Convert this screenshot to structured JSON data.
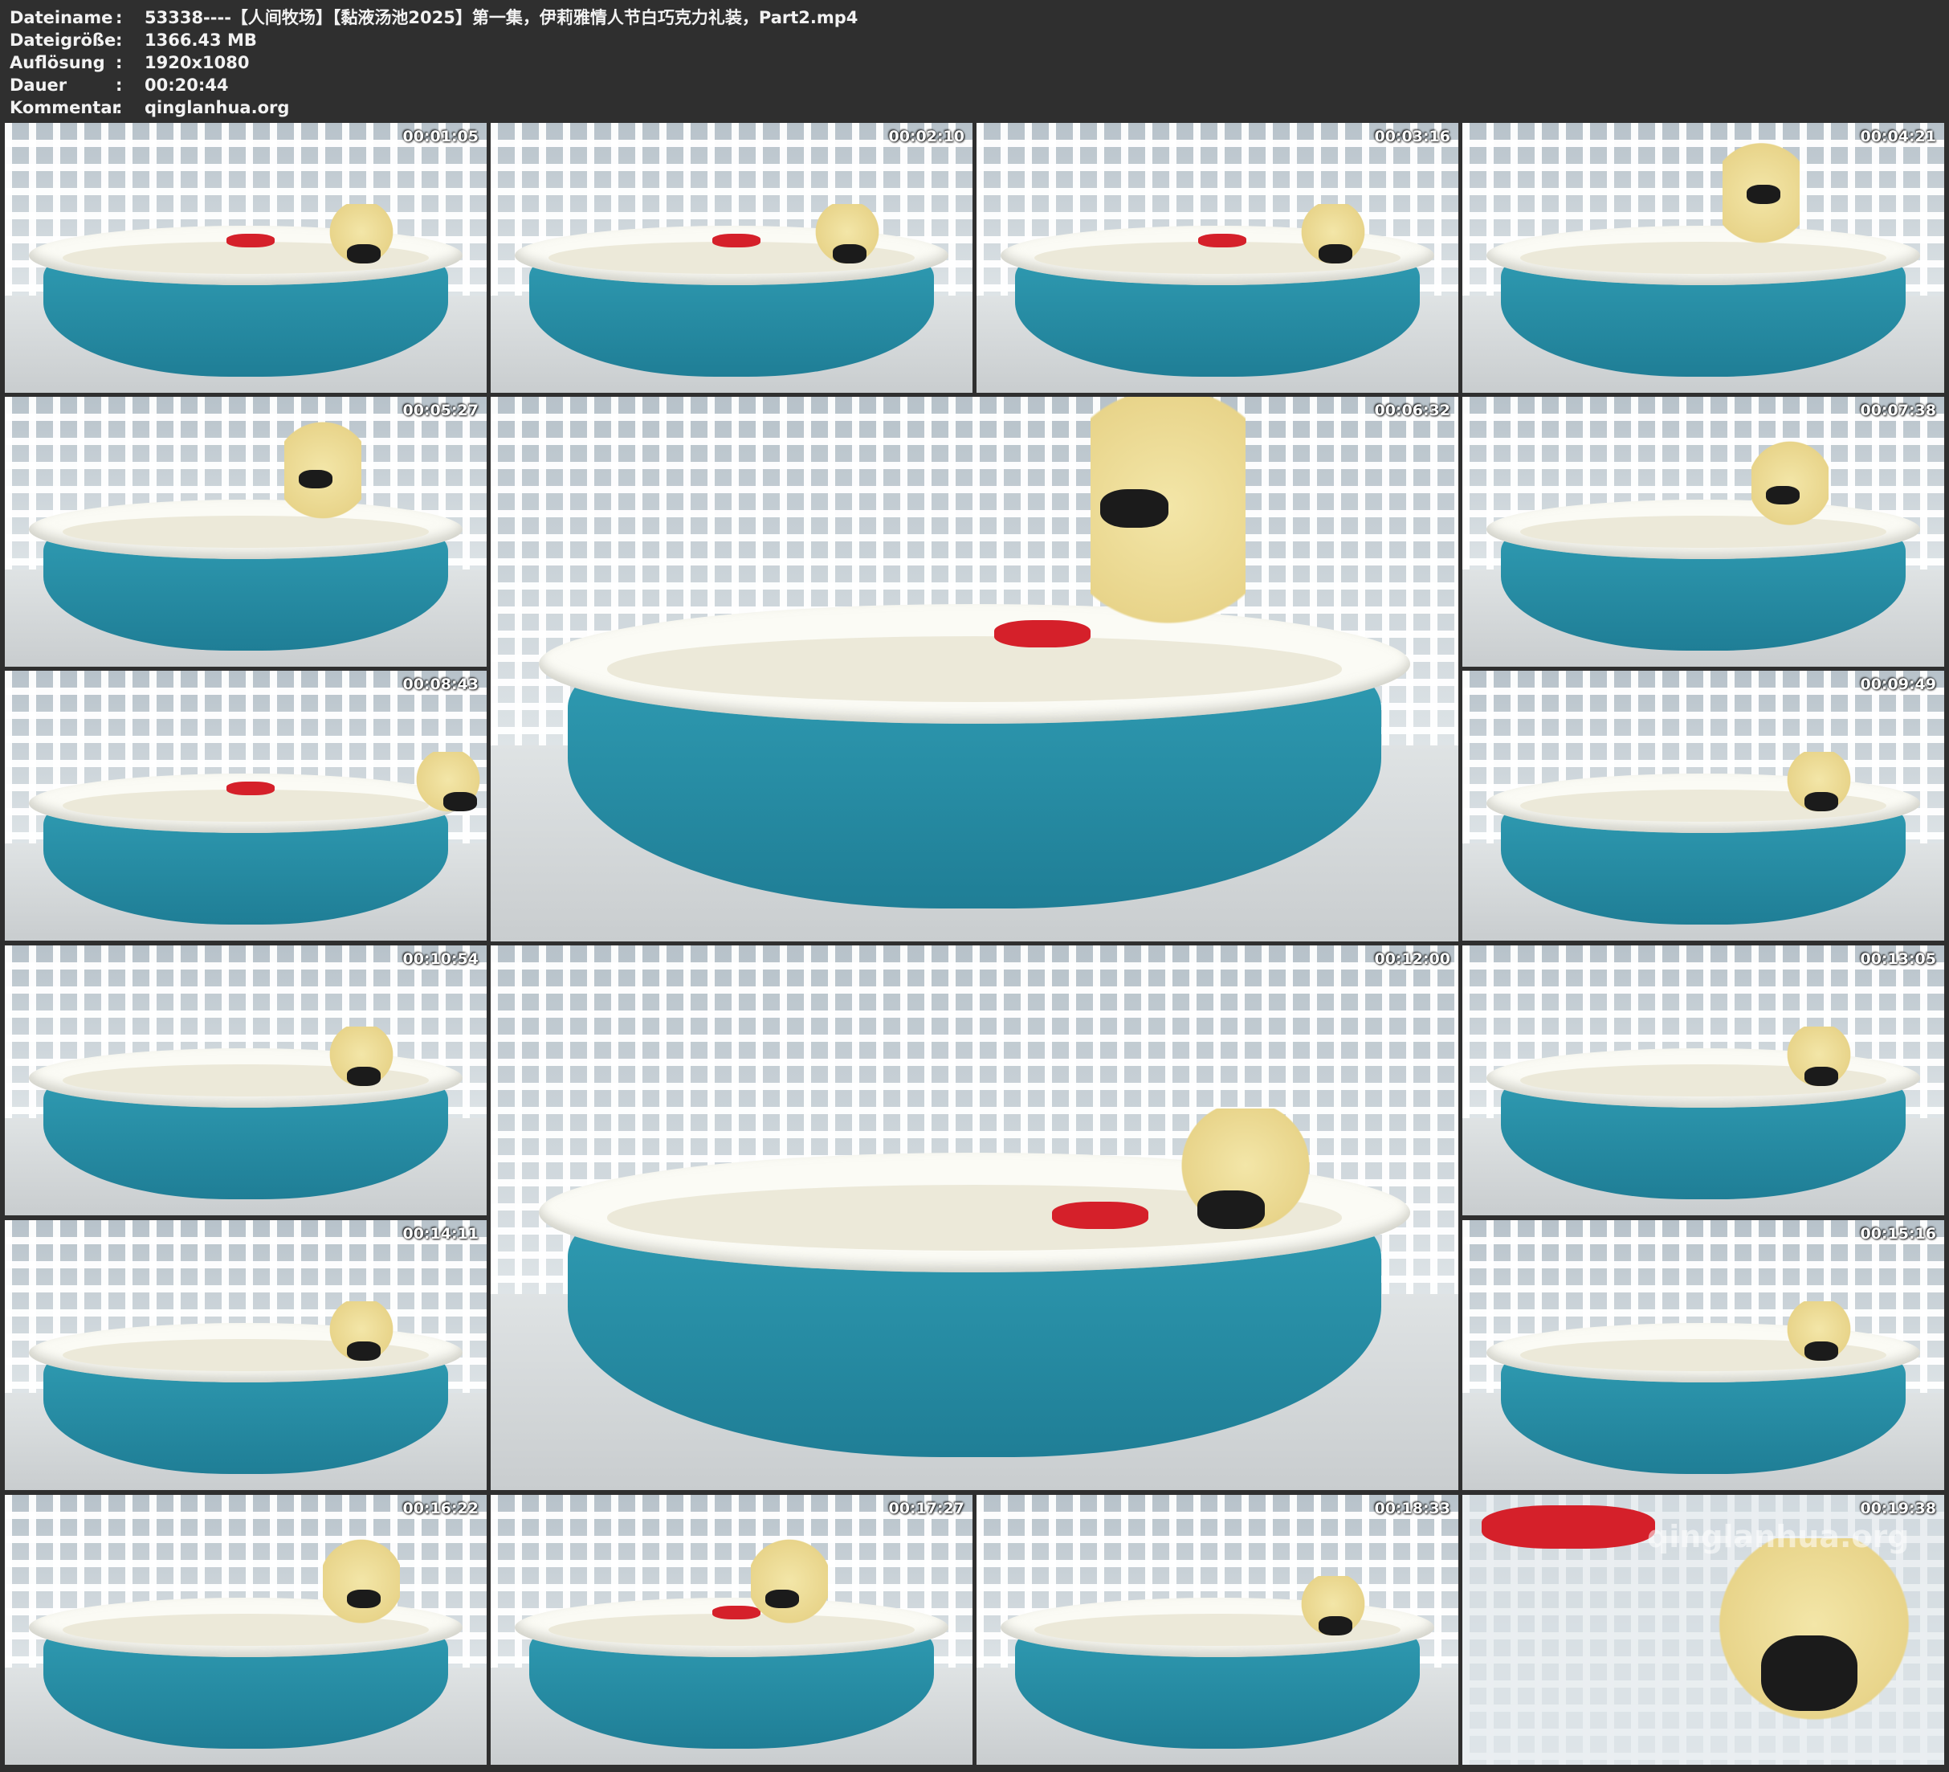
{
  "header": {
    "rows": [
      {
        "key": "Dateiname",
        "sep": ":",
        "value": "53338----【人间牧场】【黏液汤池2025】第一集，伊莉雅情人节白巧克力礼装，Part2.mp4"
      },
      {
        "key": "Dateigröße",
        "sep": ":",
        "value": "1366.43 MB"
      },
      {
        "key": "Auflösung",
        "sep": ":",
        "value": "1920x1080"
      },
      {
        "key": "Dauer",
        "sep": ":",
        "value": "00:20:44"
      },
      {
        "key": "Kommentar",
        "sep": ":",
        "value": "qinglanhua.org"
      }
    ]
  },
  "thumbnails": [
    {
      "timestamp": "00:01:05"
    },
    {
      "timestamp": "00:02:10"
    },
    {
      "timestamp": "00:03:16"
    },
    {
      "timestamp": "00:04:21"
    },
    {
      "timestamp": "00:05:27"
    },
    {
      "timestamp": "00:06:32"
    },
    {
      "timestamp": "00:07:38"
    },
    {
      "timestamp": "00:08:43"
    },
    {
      "timestamp": "00:09:49"
    },
    {
      "timestamp": "00:10:54"
    },
    {
      "timestamp": "00:12:00"
    },
    {
      "timestamp": "00:13:05"
    },
    {
      "timestamp": "00:14:11"
    },
    {
      "timestamp": "00:15:16"
    },
    {
      "timestamp": "00:16:22"
    },
    {
      "timestamp": "00:17:27"
    },
    {
      "timestamp": "00:18:33"
    },
    {
      "timestamp": "00:19:38"
    }
  ],
  "watermark": "qinglanhua.org"
}
